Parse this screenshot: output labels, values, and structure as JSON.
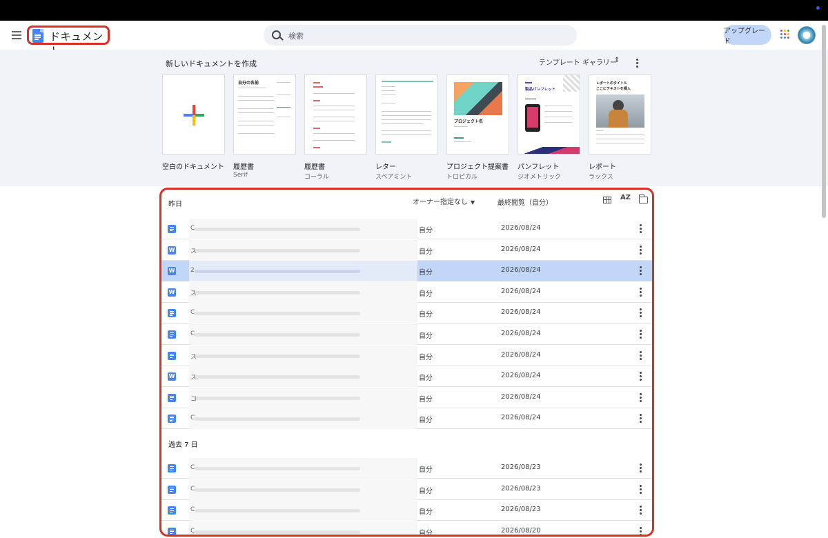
{
  "header": {
    "app_title": "ドキュメント",
    "search_placeholder": "検索",
    "upgrade_label": "アップグレード"
  },
  "templates": {
    "heading": "新しいドキュメントを作成",
    "gallery_label": "テンプレート ギャラリー",
    "items": [
      {
        "name": "空白のドキュメント",
        "sub": ""
      },
      {
        "name": "履歴書",
        "sub": "Serif",
        "thumb_title": "自分の名前"
      },
      {
        "name": "履歴書",
        "sub": "コーラル"
      },
      {
        "name": "レター",
        "sub": "スペアミント"
      },
      {
        "name": "プロジェクト提案書",
        "sub": "トロピカル",
        "thumb_title": "プロジェクト名"
      },
      {
        "name": "パンフレット",
        "sub": "ジオメトリック",
        "thumb_title": "製品パンフレット"
      },
      {
        "name": "レポート",
        "sub": "ラックス",
        "thumb_title": "レポートのタイトル",
        "thumb_sub": "ここにテキストを挿入"
      }
    ]
  },
  "list": {
    "owner_filter": "オーナー指定なし",
    "date_column": "最終閲覧（自分）",
    "sort_icon_text": "AZ",
    "sections": [
      {
        "label": "昨日",
        "rows": [
          {
            "type": "doc",
            "initial": "C",
            "owner": "自分",
            "date": "2026/08/24",
            "selected": false
          },
          {
            "type": "word",
            "initial": "ス",
            "owner": "自分",
            "date": "2026/08/24",
            "selected": false
          },
          {
            "type": "word",
            "initial": "2",
            "owner": "自分",
            "date": "2026/08/24",
            "selected": true
          },
          {
            "type": "word",
            "initial": "ス",
            "owner": "自分",
            "date": "2026/08/24",
            "selected": false
          },
          {
            "type": "doc",
            "initial": "C",
            "owner": "自分",
            "date": "2026/08/24",
            "selected": false
          },
          {
            "type": "doc",
            "initial": "C",
            "owner": "自分",
            "date": "2026/08/24",
            "selected": false
          },
          {
            "type": "doc",
            "initial": "ス",
            "owner": "自分",
            "date": "2026/08/24",
            "selected": false
          },
          {
            "type": "word",
            "initial": "ス",
            "owner": "自分",
            "date": "2026/08/24",
            "selected": false
          },
          {
            "type": "doc",
            "initial": "コ",
            "owner": "自分",
            "date": "2026/08/24",
            "selected": false
          },
          {
            "type": "doc",
            "initial": "C",
            "owner": "自分",
            "date": "2026/08/24",
            "selected": false
          }
        ]
      },
      {
        "label": "過去 7 日",
        "rows": [
          {
            "type": "doc",
            "initial": "C",
            "owner": "自分",
            "date": "2026/08/23",
            "selected": false
          },
          {
            "type": "doc",
            "initial": "C",
            "owner": "自分",
            "date": "2026/08/23",
            "selected": false
          },
          {
            "type": "doc",
            "initial": "C",
            "owner": "自分",
            "date": "2026/08/23",
            "selected": false
          },
          {
            "type": "doc",
            "initial": "C",
            "owner": "自分",
            "date": "2026/08/20",
            "selected": false
          }
        ]
      }
    ]
  },
  "colors": {
    "accent": "#4285f4",
    "highlight_border": "#d93025",
    "selected_row": "#c2d7f8",
    "template_bg": "#f0f4f9"
  }
}
